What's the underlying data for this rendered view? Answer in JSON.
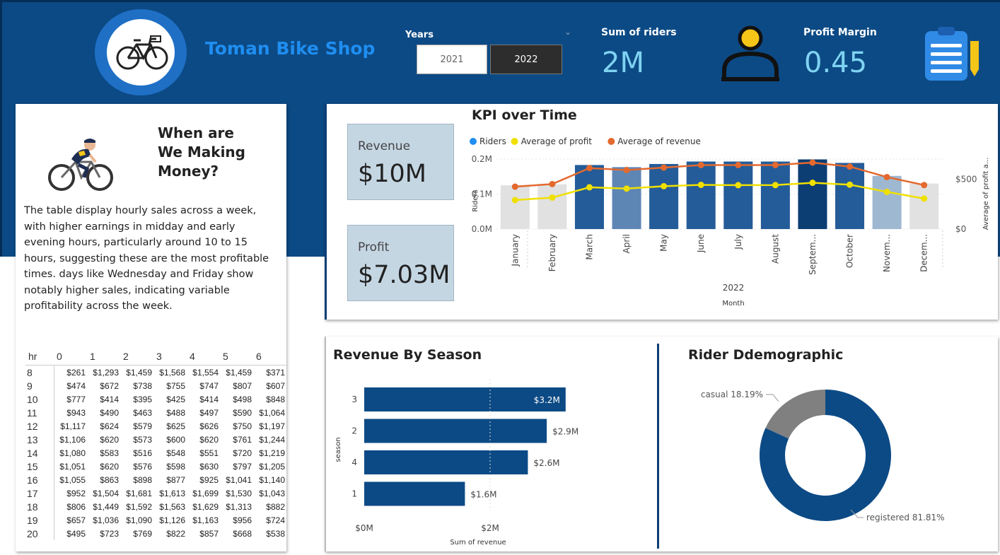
{
  "header": {
    "shop_name": "Toman Bike Shop",
    "years_label": "Years",
    "year_options": [
      "2021",
      "2022"
    ],
    "selected_year": "2022",
    "riders_label": "Sum of riders",
    "riders_value": "2M",
    "profit_margin_label": "Profit Margin",
    "profit_margin_value": "0.45"
  },
  "story": {
    "title_line1": "When are",
    "title_line2": "We Making",
    "title_line3": "Money?",
    "description": "The table display hourly sales across a week, with higher earnings in midday and early evening hours, particularly around 10 to 15 hours, suggesting these are the most profitable times. days like Wednesday and Friday show notably higher sales, indicating variable profitability across the week."
  },
  "hourly_table": {
    "corner_header": "hr",
    "columns": [
      "0",
      "1",
      "2",
      "3",
      "4",
      "5",
      "6"
    ],
    "rows": [
      {
        "hr": "8",
        "values": [
          "$261",
          "$1,293",
          "$1,459",
          "$1,568",
          "$1,554",
          "$1,459",
          "$371"
        ]
      },
      {
        "hr": "9",
        "values": [
          "$474",
          "$672",
          "$738",
          "$755",
          "$747",
          "$807",
          "$607"
        ]
      },
      {
        "hr": "10",
        "values": [
          "$777",
          "$414",
          "$395",
          "$425",
          "$414",
          "$498",
          "$848"
        ]
      },
      {
        "hr": "11",
        "values": [
          "$943",
          "$490",
          "$463",
          "$488",
          "$497",
          "$590",
          "$1,064"
        ]
      },
      {
        "hr": "12",
        "values": [
          "$1,117",
          "$624",
          "$579",
          "$625",
          "$626",
          "$750",
          "$1,197"
        ]
      },
      {
        "hr": "13",
        "values": [
          "$1,106",
          "$620",
          "$573",
          "$600",
          "$620",
          "$761",
          "$1,244"
        ]
      },
      {
        "hr": "14",
        "values": [
          "$1,080",
          "$583",
          "$516",
          "$548",
          "$551",
          "$720",
          "$1,219"
        ]
      },
      {
        "hr": "15",
        "values": [
          "$1,051",
          "$620",
          "$576",
          "$598",
          "$630",
          "$797",
          "$1,205"
        ]
      },
      {
        "hr": "16",
        "values": [
          "$1,055",
          "$863",
          "$898",
          "$877",
          "$925",
          "$1,041",
          "$1,140"
        ]
      },
      {
        "hr": "17",
        "values": [
          "$952",
          "$1,504",
          "$1,681",
          "$1,613",
          "$1,699",
          "$1,530",
          "$1,043"
        ]
      },
      {
        "hr": "18",
        "values": [
          "$806",
          "$1,449",
          "$1,592",
          "$1,563",
          "$1,629",
          "$1,313",
          "$882"
        ]
      },
      {
        "hr": "19",
        "values": [
          "$657",
          "$1,036",
          "$1,090",
          "$1,126",
          "$1,163",
          "$956",
          "$724"
        ]
      },
      {
        "hr": "20",
        "values": [
          "$495",
          "$723",
          "$769",
          "$822",
          "$857",
          "$668",
          "$538"
        ]
      }
    ]
  },
  "kpi_over_time": {
    "title": "KPI over Time",
    "revenue_label": "Revenue",
    "revenue_value": "$10M",
    "profit_label": "Profit",
    "profit_value": "$7.03M"
  },
  "revenue_by_season": {
    "title": "Revenue By Season"
  },
  "rider_demographic": {
    "title": "Rider Ddemographic"
  },
  "colors": {
    "banner": "#0c4a85",
    "riders_bar_dark": "#0c4a85",
    "profit_line": "#f0e000",
    "revenue_line": "#e3692e",
    "kpi_value": "#7fd3f2",
    "casual": "#808080",
    "registered": "#0c4a85"
  },
  "chart_data": [
    {
      "type": "bar",
      "title": "KPI over Time",
      "categories": [
        "January",
        "February",
        "March",
        "April",
        "May",
        "June",
        "July",
        "August",
        "Septem...",
        "October",
        "Novem...",
        "Decem..."
      ],
      "axis_group_label": "2022",
      "xlabel": "Month",
      "ylabel": "Riders",
      "y2label": "Average of profit a...",
      "ylim": [
        0,
        200000
      ],
      "y_ticks": [
        "0.0M",
        "0.1M",
        "0.2M"
      ],
      "y2lim": [
        0,
        700
      ],
      "y2_ticks": [
        "$0",
        "$500"
      ],
      "legend": [
        "Riders",
        "Average of profit",
        "Average of revenue"
      ],
      "legend_position": "top-left",
      "series": [
        {
          "name": "Riders",
          "type": "bar",
          "values": [
            125000,
            128000,
            183000,
            177000,
            186000,
            193000,
            193000,
            193000,
            199000,
            189000,
            152000,
            130000
          ]
        },
        {
          "name": "Average of profit",
          "type": "line",
          "values": [
            290,
            315,
            418,
            405,
            429,
            442,
            439,
            440,
            463,
            444,
            372,
            305
          ]
        },
        {
          "name": "Average of revenue",
          "type": "line",
          "values": [
            424,
            450,
            610,
            590,
            615,
            640,
            640,
            640,
            665,
            625,
            520,
            440
          ]
        }
      ]
    },
    {
      "type": "bar",
      "orientation": "horizontal",
      "title": "Revenue By Season",
      "categories": [
        "3",
        "2",
        "4",
        "1"
      ],
      "values": [
        3200000,
        2900000,
        2600000,
        1600000
      ],
      "data_labels": [
        "$3.2M",
        "$2.9M",
        "$2.6M",
        "$1.6M"
      ],
      "xlabel": "Sum of revenue",
      "ylabel": "season",
      "xlim": [
        0,
        3800000
      ],
      "x_ticks": [
        "$0M",
        "$2M"
      ]
    },
    {
      "type": "pie",
      "donut": true,
      "title": "Rider Ddemographic",
      "labels": [
        "casual",
        "registered"
      ],
      "values": [
        18.19,
        81.81
      ],
      "data_labels": [
        "casual 18.19%",
        "registered 81.81%"
      ]
    }
  ]
}
